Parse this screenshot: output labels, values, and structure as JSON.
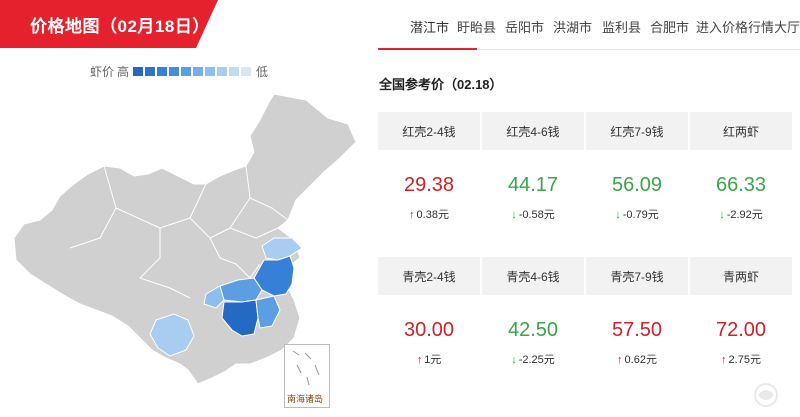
{
  "header": {
    "title": "价格地图（02月18日）",
    "accent_color": "#e6212e"
  },
  "nav": {
    "tabs": [
      "潜江市",
      "盱眙县",
      "岳阳市",
      "洪湖市",
      "监利县",
      "合肥市",
      "进入价格行情大厅"
    ],
    "active_index": 0
  },
  "legend": {
    "prefix": "虾价",
    "high": "高",
    "low": "低",
    "colors": [
      "#2569c7",
      "#2d74cf",
      "#3780d7",
      "#468edc",
      "#5c9ee2",
      "#74aee8",
      "#8ebeed",
      "#a8cdf0",
      "#c2dbf2",
      "#dbe8f4"
    ]
  },
  "map": {
    "inset_label": "南海诸岛"
  },
  "reference": {
    "title": "全国参考价（02.18）",
    "red_shell": [
      {
        "name": "红壳2-4钱",
        "price": "29.38",
        "change": "0.38元",
        "direction": "up"
      },
      {
        "name": "红壳4-6钱",
        "price": "44.17",
        "change": "-0.58元",
        "direction": "down"
      },
      {
        "name": "红壳7-9钱",
        "price": "56.09",
        "change": "-0.79元",
        "direction": "down"
      },
      {
        "name": "红两虾",
        "price": "66.33",
        "change": "-2.92元",
        "direction": "down"
      }
    ],
    "green_shell": [
      {
        "name": "青壳2-4钱",
        "price": "30.00",
        "change": "1元",
        "direction": "up"
      },
      {
        "name": "青壳4-6钱",
        "price": "42.50",
        "change": "-2.25元",
        "direction": "down"
      },
      {
        "name": "青壳7-9钱",
        "price": "57.50",
        "change": "0.62元",
        "direction": "up"
      },
      {
        "name": "青两虾",
        "price": "72.00",
        "change": "2.75元",
        "direction": "up"
      }
    ]
  },
  "colors": {
    "up": "#d0202a",
    "down": "#3aa64a",
    "map_base": "#d0d0d0"
  }
}
